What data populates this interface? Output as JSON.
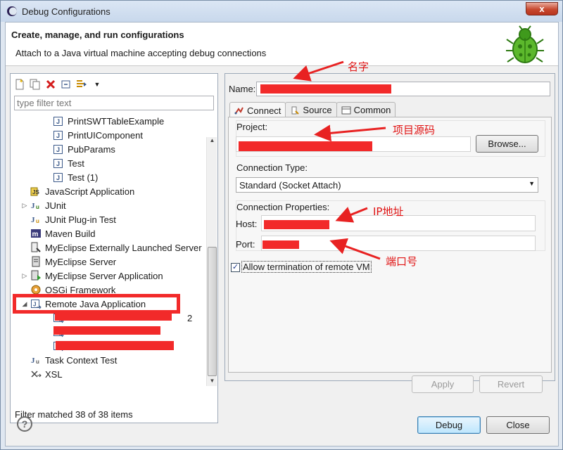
{
  "window": {
    "title": "Debug Configurations",
    "close_glyph": "x"
  },
  "banner": {
    "heading": "Create, manage, and run configurations",
    "description": "Attach to a Java virtual machine accepting debug connections"
  },
  "left_panel": {
    "filter_placeholder": "type filter text",
    "status": "Filter matched 38 of 38 items",
    "tree": [
      {
        "label": "PrintSWTTableExample",
        "icon": "java-launch-icon",
        "indent": 2
      },
      {
        "label": "PrintUIComponent",
        "icon": "java-launch-icon",
        "indent": 2
      },
      {
        "label": "PubParams",
        "icon": "java-launch-icon",
        "indent": 2
      },
      {
        "label": "Test",
        "icon": "java-launch-icon",
        "indent": 2
      },
      {
        "label": "Test (1)",
        "icon": "java-launch-icon",
        "indent": 2
      },
      {
        "label": "JavaScript Application",
        "icon": "javascript-icon",
        "indent": 1
      },
      {
        "label": "JUnit",
        "icon": "junit-icon",
        "indent": 1,
        "expander": "▷"
      },
      {
        "label": "JUnit Plug-in Test",
        "icon": "junit-plugin-icon",
        "indent": 1
      },
      {
        "label": "Maven Build",
        "icon": "maven-icon",
        "indent": 1
      },
      {
        "label": "MyEclipse Externally Launched Server",
        "icon": "external-server-icon",
        "indent": 1
      },
      {
        "label": "MyEclipse Server",
        "icon": "server-icon",
        "indent": 1
      },
      {
        "label": "MyEclipse Server Application",
        "icon": "server-app-icon",
        "indent": 1,
        "expander": "▷"
      },
      {
        "label": "OSGi Framework",
        "icon": "osgi-icon",
        "indent": 1
      },
      {
        "label": "Remote Java Application",
        "icon": "remote-java-icon",
        "indent": 1,
        "expander": "◢"
      },
      {
        "label": "2",
        "icon": "remote-java-icon",
        "indent": 2
      },
      {
        "label": "",
        "icon": "remote-java-icon",
        "indent": 2
      },
      {
        "label": "",
        "icon": "remote-java-icon",
        "indent": 2
      },
      {
        "label": "Task Context Test",
        "icon": "task-context-icon",
        "indent": 1
      },
      {
        "label": "XSL",
        "icon": "xsl-icon",
        "indent": 1
      }
    ]
  },
  "right_panel": {
    "name_label": "Name:",
    "tabs": [
      {
        "label": "Connect",
        "icon": "connect-icon",
        "active": true
      },
      {
        "label": "Source",
        "icon": "source-icon",
        "active": false
      },
      {
        "label": "Common",
        "icon": "common-icon",
        "active": false
      }
    ],
    "project_label": "Project:",
    "browse_label": "Browse...",
    "connection_type_label": "Connection Type:",
    "connection_type_value": "Standard (Socket Attach)",
    "connection_properties_label": "Connection Properties:",
    "host_label": "Host:",
    "port_label": "Port:",
    "allow_termination_label": "Allow termination of remote VM",
    "allow_termination_checked": true
  },
  "buttons": {
    "apply": "Apply",
    "revert": "Revert",
    "debug": "Debug",
    "close": "Close"
  },
  "annotations": {
    "name": "名字",
    "project_source": "项目源码",
    "ip_address": "IP地址",
    "port_number": "端口号"
  },
  "colors": {
    "annotation": "#e01414",
    "redaction": "#f22a2a"
  }
}
